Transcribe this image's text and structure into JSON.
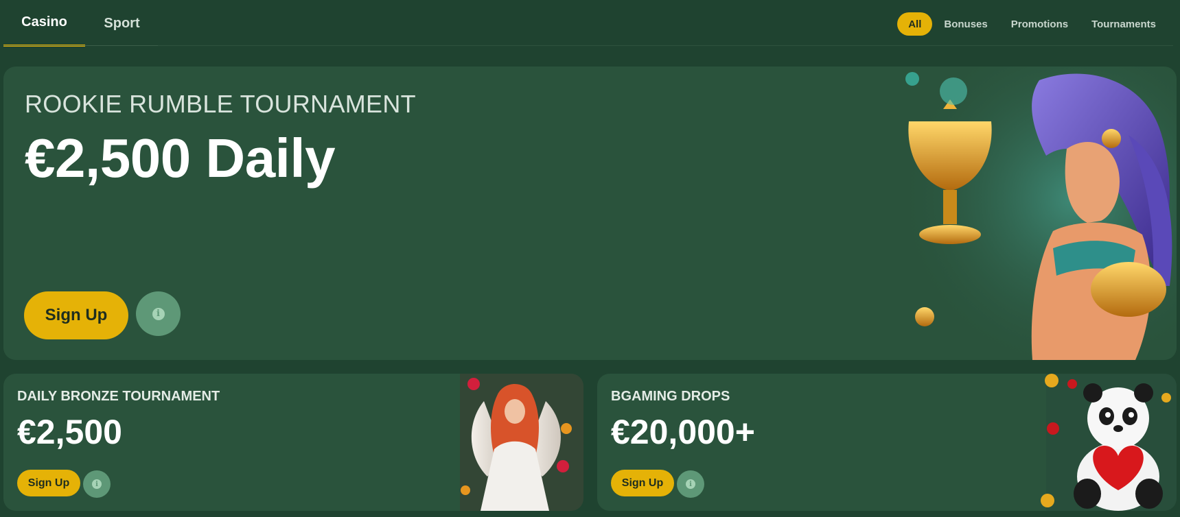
{
  "nav": {
    "tabs": [
      {
        "label": "Casino",
        "active": true
      },
      {
        "label": "Sport",
        "active": false
      }
    ],
    "filters": [
      {
        "label": "All",
        "active": true
      },
      {
        "label": "Bonuses",
        "active": false
      },
      {
        "label": "Promotions",
        "active": false
      },
      {
        "label": "Tournaments",
        "active": false
      }
    ]
  },
  "hero": {
    "kicker": "ROOKIE RUMBLE TOURNAMENT",
    "amount": "€2,500 Daily",
    "signup_label": "Sign Up",
    "info_glyph": "i"
  },
  "cards": [
    {
      "kicker": "DAILY BRONZE TOURNAMENT",
      "amount": "€2,500",
      "signup_label": "Sign Up",
      "info_glyph": "i"
    },
    {
      "kicker": "BGAMING DROPS",
      "amount": "€20,000+",
      "signup_label": "Sign Up",
      "info_glyph": "i"
    }
  ],
  "colors": {
    "background": "#1f4330",
    "card": "#2a533c",
    "accent": "#e5b207",
    "info_button": "#5e9877"
  }
}
